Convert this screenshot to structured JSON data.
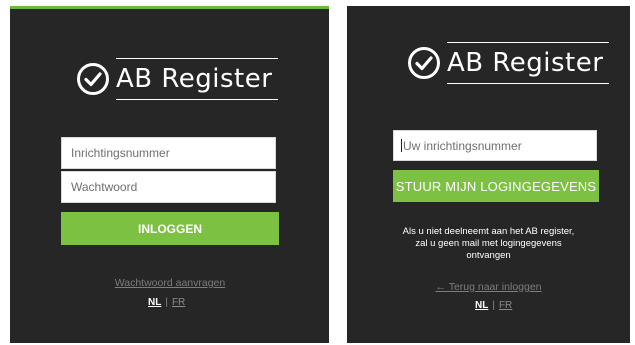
{
  "brand": {
    "logo_text": "AB Register",
    "accent_color": "#7dc142",
    "panel_color": "#262626",
    "logo_icon": "check-circle-icon"
  },
  "login_panel": {
    "username_placeholder": "Inrichtingsnummer",
    "password_placeholder": "Wachtwoord",
    "login_button": "INLOGGEN",
    "forgot_link": "Wachtwoord aanvragen",
    "lang_active": "NL",
    "lang_separator": "|",
    "lang_other": "FR"
  },
  "reset_panel": {
    "number_placeholder": "Uw inrichtingsnummer",
    "send_button": "STUUR MIJN LOGINGEGEVENS",
    "info_line1": "Als u niet deelneemt aan het AB register,",
    "info_line2": "zal u geen mail met logingegevens",
    "info_line3": "ontvangen",
    "back_link": "← Terug naar inloggen",
    "lang_active": "NL",
    "lang_separator": "|",
    "lang_other": "FR"
  }
}
